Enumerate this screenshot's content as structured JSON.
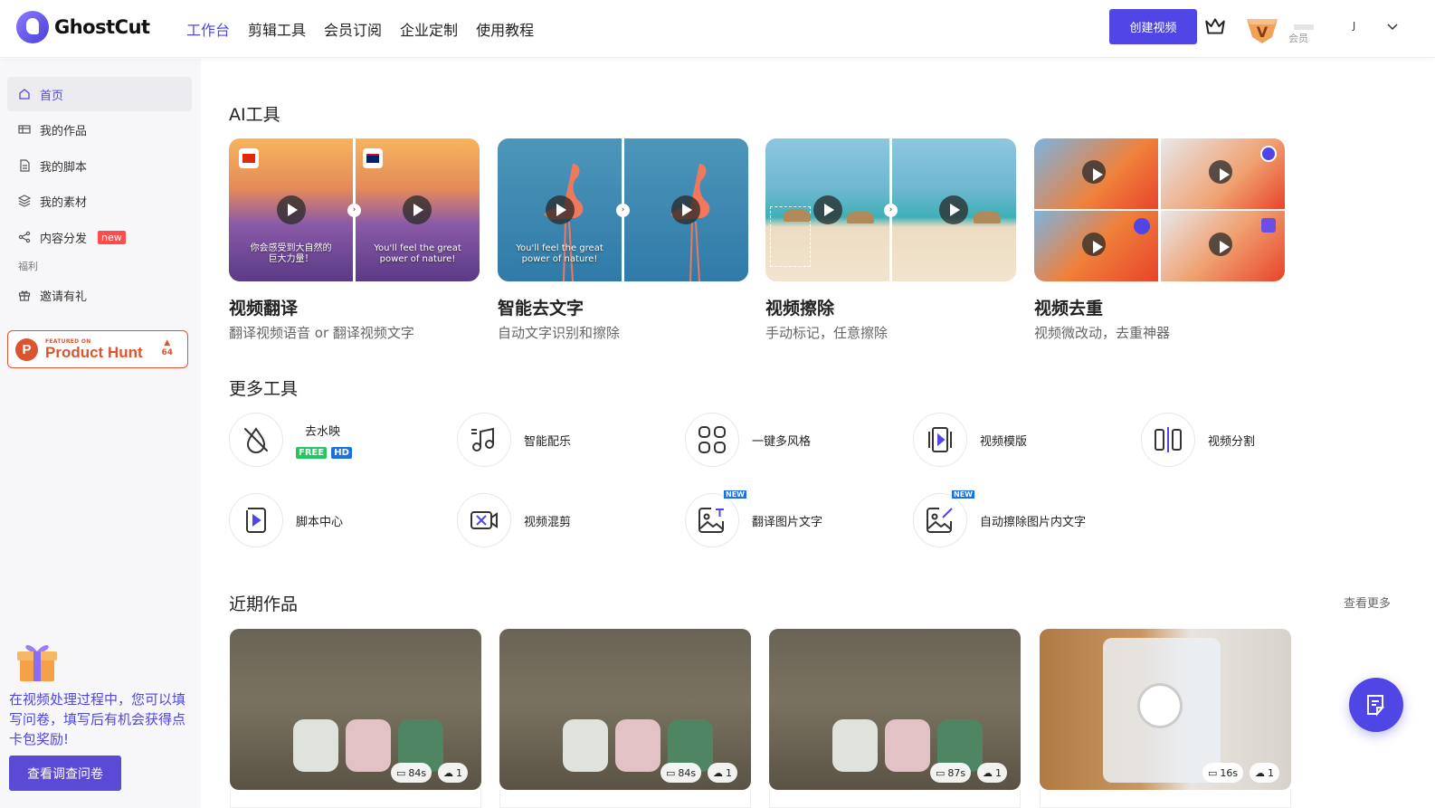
{
  "app": {
    "name": "GhostCut"
  },
  "nav": {
    "items": [
      "工作台",
      "剪辑工具",
      "会员订阅",
      "企业定制",
      "使用教程"
    ],
    "active": "工作台"
  },
  "header": {
    "create_label": "创建视频",
    "vip_label": "会员",
    "user_initial": "J"
  },
  "sidebar": {
    "items": [
      {
        "label": "首页",
        "icon": "home-icon",
        "active": true
      },
      {
        "label": "我的作品",
        "icon": "works-icon"
      },
      {
        "label": "我的脚本",
        "icon": "script-icon"
      },
      {
        "label": "我的素材",
        "icon": "layers-icon"
      },
      {
        "label": "内容分发",
        "icon": "share-icon",
        "badge": "new"
      }
    ],
    "section_label": "福利",
    "invite": {
      "label": "邀请有礼",
      "icon": "gift-icon"
    },
    "product_hunt": {
      "featured": "FEATURED ON",
      "name": "Product Hunt",
      "votes": "64"
    },
    "promo_text": "在视频处理过程中，您可以填写问卷，填写后有机会获得点卡包奖励!",
    "survey_label": "查看调查问卷"
  },
  "ai_tools": {
    "title": "AI工具",
    "cards": [
      {
        "title": "视频翻译",
        "desc": "翻译视频语音 or 翻译视频文字",
        "left_caption": "你会感受到大自然的\n巨大力量！",
        "right_caption": "You'll feel the great\npower of nature!"
      },
      {
        "title": "智能去文字",
        "desc": "自动文字识别和擦除",
        "left_caption": "You'll feel the great\npower of nature!"
      },
      {
        "title": "视频擦除",
        "desc": "手动标记，任意擦除"
      },
      {
        "title": "视频去重",
        "desc": "视频微改动，去重神器"
      }
    ]
  },
  "more_tools": {
    "title": "更多工具",
    "items": [
      {
        "label": "去水映",
        "icon": "no-watermark-icon",
        "badges": [
          "FREE",
          "HD"
        ]
      },
      {
        "label": "智能配乐",
        "icon": "music-icon"
      },
      {
        "label": "一键多风格",
        "icon": "grid-icon"
      },
      {
        "label": "视频模版",
        "icon": "video-template-icon"
      },
      {
        "label": "视频分割",
        "icon": "split-icon"
      },
      {
        "label": "脚本中心",
        "icon": "script-center-icon"
      },
      {
        "label": "视频混剪",
        "icon": "video-mix-icon"
      },
      {
        "label": "翻译图片文字",
        "icon": "image-translate-icon",
        "flag": "NEW"
      },
      {
        "label": "自动擦除图片内文字",
        "icon": "image-erase-icon",
        "flag": "NEW"
      }
    ]
  },
  "recent": {
    "title": "近期作品",
    "see_more": "查看更多",
    "items": [
      {
        "duration": "84s",
        "count": "1"
      },
      {
        "duration": "84s",
        "count": "1"
      },
      {
        "duration": "87s",
        "count": "1"
      },
      {
        "duration": "16s",
        "count": "1"
      }
    ]
  },
  "colors": {
    "accent": "#4f46e5",
    "product_hunt": "#da552f",
    "new_badge": "#ff4d4f"
  }
}
